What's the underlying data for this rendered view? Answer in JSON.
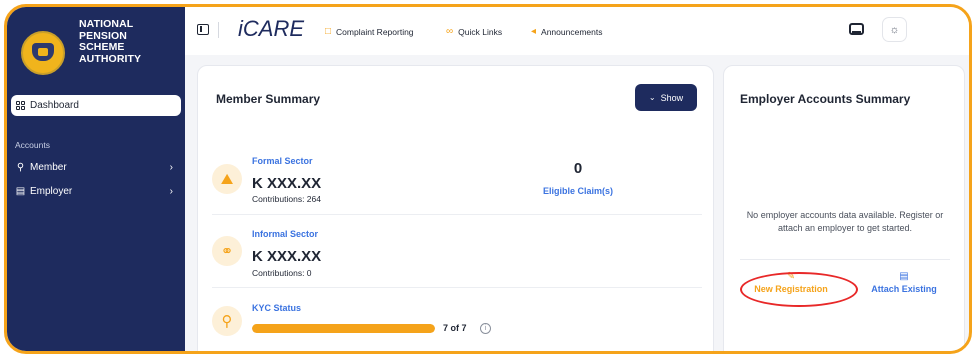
{
  "sidebar": {
    "org_name_lines": [
      "NATIONAL",
      "PENSION",
      "SCHEME",
      "AUTHORITY"
    ],
    "logo_icon": "napsa-emblem",
    "dashboard_label": "Dashboard",
    "accounts_section": "Accounts",
    "items": [
      {
        "label": "Member",
        "icon": "user-icon"
      },
      {
        "label": "Employer",
        "icon": "briefcase-icon"
      }
    ]
  },
  "topbar": {
    "app_title": "iCARE",
    "links": [
      {
        "label": "Complaint Reporting",
        "icon": "message-icon"
      },
      {
        "label": "Quick Links",
        "icon": "link-icon"
      },
      {
        "label": "Announcements",
        "icon": "megaphone-icon"
      }
    ]
  },
  "member_summary": {
    "title": "Member Summary",
    "show_button": "Show",
    "formal": {
      "label": "Formal Sector",
      "amount": "K XXX.XX",
      "contributions": "Contributions: 264"
    },
    "claims": {
      "count": "0",
      "label": "Eligible Claim(s)"
    },
    "informal": {
      "label": "Informal Sector",
      "amount": "K XXX.XX",
      "contributions": "Contributions: 0"
    },
    "kyc": {
      "label": "KYC Status",
      "progress_text": "7 of 7",
      "progress_fraction": 1.0
    }
  },
  "employer_summary": {
    "title": "Employer Accounts Summary",
    "empty_message": "No employer accounts data available. Register or attach an employer to get started.",
    "new_registration": "New Registration",
    "attach_existing": "Attach Existing"
  },
  "colors": {
    "navy": "#1e2b5e",
    "accent_orange": "#f5a31a",
    "link_blue": "#3b73e0",
    "highlight_red": "#e82828"
  }
}
